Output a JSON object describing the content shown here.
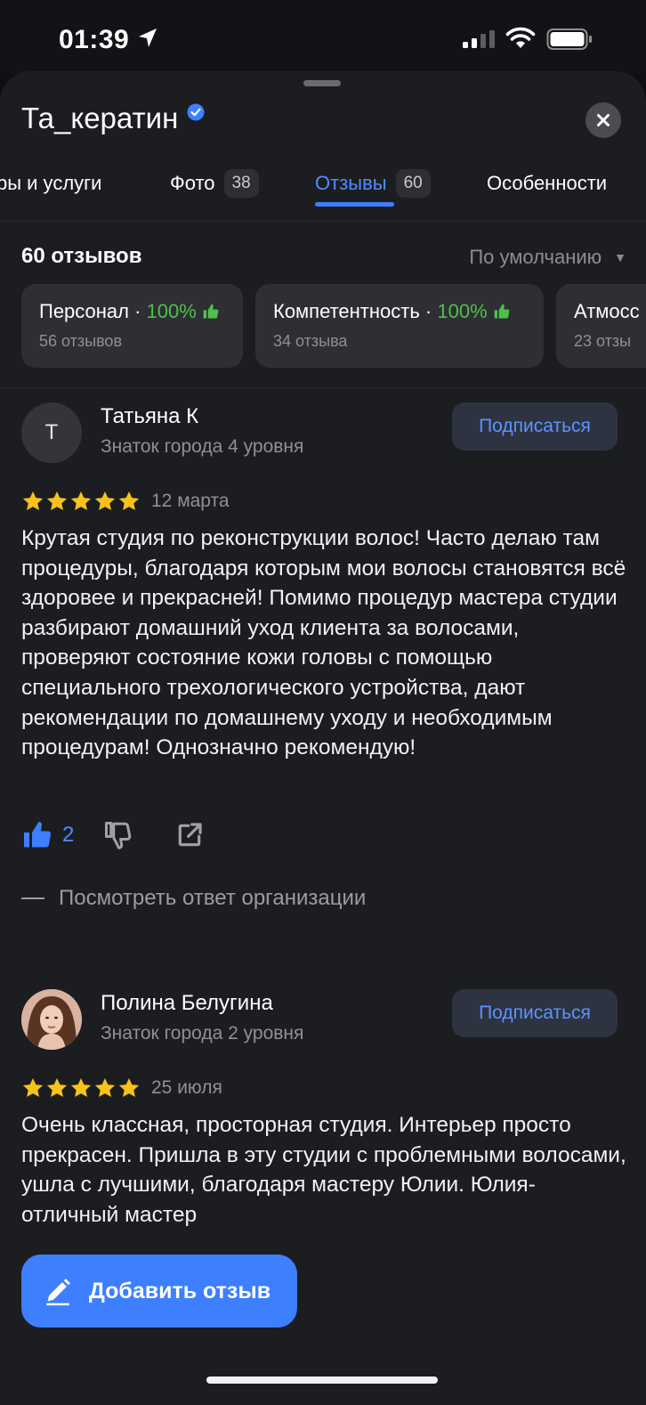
{
  "status_bar": {
    "time": "01:39"
  },
  "sheet": {
    "title": "Та_кератин",
    "tabs": [
      {
        "label": "ры и услуги",
        "badge": ""
      },
      {
        "label": "Фото",
        "badge": "38"
      },
      {
        "label": "Отзывы",
        "badge": "60",
        "active": true
      },
      {
        "label": "Особенности",
        "badge": ""
      }
    ]
  },
  "reviews_header": {
    "count": "60 отзывов",
    "sort": "По умолчанию"
  },
  "aspects": [
    {
      "name": "Персонал",
      "sep": " · ",
      "percent": "100%",
      "reviews": "56 отзывов"
    },
    {
      "name": "Компетентность",
      "sep": " · ",
      "percent": "100%",
      "reviews": "34 отзыва"
    },
    {
      "name": "Атмосс",
      "sep": "",
      "percent": "",
      "reviews": "23 отзы"
    }
  ],
  "reviews": [
    {
      "avatar_letter": "Т",
      "author": "Татьяна К",
      "level": "Знаток города 4 уровня",
      "subscribe": "Подписаться",
      "rating": 5,
      "date": "12 марта",
      "text": "Крутая студия по реконструкции волос! Часто делаю там процедуры, благодаря которым мои волосы становятся всё здоровее и прекрасней! Помимо процедур мастера студии разбирают домашний уход клиента за волосами, проверяют состояние кожи головы с помощью специального трехологического устройства, дают рекомендации по домашнему уходу и необходимым процедурам! Однозначно рекомендую!",
      "likes": "2",
      "org_reply": "Посмотреть ответ организации"
    },
    {
      "author": "Полина Белугина",
      "level": "Знаток города 2 уровня",
      "subscribe": "Подписаться",
      "rating": 5,
      "date": "25 июля",
      "text": "Очень классная, просторная студия. Интерьер просто прекрасен. Пришла в эту студии с проблемными волосами, ушла с лучшими, благодаря мастеру Юлии. Юлия-отличный мастер"
    }
  ],
  "fab": {
    "label": "Добавить отзыв"
  },
  "colors": {
    "accent": "#3d7fff",
    "positive": "#4fc04a",
    "sheet_bg": "#1c1d21"
  },
  "icons": [
    "location-arrow-icon",
    "cellular-signal-icon",
    "wifi-icon",
    "battery-icon",
    "verified-badge-icon",
    "close-icon",
    "caret-down-icon",
    "thumbs-up-icon",
    "thumbs-down-icon",
    "share-icon",
    "star-icon",
    "pencil-icon"
  ]
}
